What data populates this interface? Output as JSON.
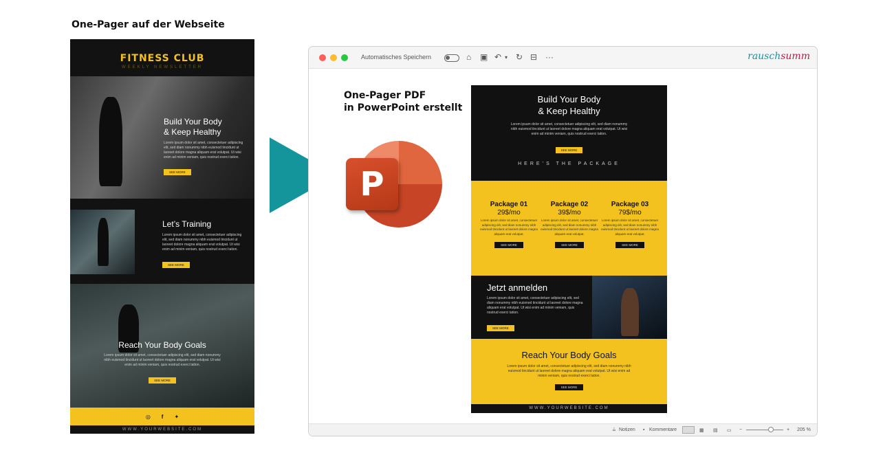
{
  "left": {
    "heading": "One-Pager auf der Webseite",
    "brand": "FITNESS CLUB",
    "brand_sub": "WEEKLY NEWSLETTER",
    "hero_title_1": "Build Your Body",
    "hero_title_2": "& Keep Healthy",
    "hero_lorem": "Lorem ipsum dolor sit amet, consectetuer adipiscing elit, sed diam nonummy nibh euismod tincidunt ut laoreet dolore magna aliquam erat volutpat. Ut wisi enim ad minim veniam, quis nostrud exerci tation.",
    "btn": "SEE MORE",
    "training_title": "Let’s Training",
    "training_lorem": "Lorem ipsum dolor sit amet, consectetuer adipiscing elit, sed diam nonummy nibh euismod tincidunt ut laoreet dolore magna aliquam erat volutpat. Ut wisi enim ad minim veniam, quis nostrud exerci tation.",
    "goals_title": "Reach Your Body Goals",
    "goals_lorem": "Lorem ipsum dolor sit amet, consectetuer adipiscing elit, sed diam nonummy nibh euismod tincidunt ut laoreet dolore magna aliquam erat volutpat. Ut wisi enim ad minim veniam, quis nostrud exerci tation.",
    "website": "WWW.YOURWEBSITE.COM"
  },
  "window": {
    "autosave_label": "Automatisches Speichern",
    "logo_part1": "rausch",
    "logo_part2": "summ",
    "status": {
      "notes": "Notizen",
      "comments": "Kommentare",
      "zoom": "205 %"
    }
  },
  "pdf_caption_1": "One-Pager PDF",
  "pdf_caption_2": "in PowerPoint erstellt",
  "ppt_letter": "P",
  "pdf": {
    "hero_title_1": "Build Your Body",
    "hero_title_2": "& Keep Healthy",
    "hero_lorem": "Lorem ipsum dolor sit amet, consectetuer adipiscing elit, sed diam nonummy nibh euismod tincidunt ut laoreet dolore magna aliquam erat volutpat. Ut wisi enim ad minim veniam, quis nostrud exerci tation.",
    "btn": "SEE MORE",
    "package_heading": "HERE’S THE PACKAGE",
    "packages": [
      {
        "name": "Package 01",
        "price": "29$/mo",
        "lorem": "Lorem ipsum dolor sit amet, consectetuer adipiscing elit, sed diam nonummy nibh euismod tincidunt ut laoreet dolore magna aliquam erat volutpat."
      },
      {
        "name": "Package 02",
        "price": "39$/mo",
        "lorem": "Lorem ipsum dolor sit amet, consectetuer adipiscing elit, sed diam nonummy nibh euismod tincidunt ut laoreet dolore magna aliquam erat volutpat."
      },
      {
        "name": "Package 03",
        "price": "79$/mo",
        "lorem": "Lorem ipsum dolor sit amet, consectetuer adipiscing elit, sed diam nonummy nibh euismod tincidunt ut laoreet dolore magna aliquam erat volutpat."
      }
    ],
    "signup_title": "Jetzt anmelden",
    "signup_lorem": "Lorem ipsum dolor sit amet, consectetuer adipiscing elit, sed diam nonummy nibh euismod tincidunt ut laoreet dolore magna aliquam erat volutpat. Ut wisi enim ad minim veniam, quis nostrud exerci tation.",
    "goals_title": "Reach Your Body Goals",
    "goals_lorem": "Lorem ipsum dolor sit amet, consectetuer adipiscing elit, sed diam nonummy nibh euismod tincidunt ut laoreet dolore magna aliquam erat volutpat. Ut wisi enim ad minim veniam, quis nostrud exerci tation.",
    "website": "WWW.YOURWEBSITE.COM"
  },
  "colors": {
    "accent_yellow": "#f4c21f",
    "arrow_teal": "#14949b",
    "dark": "#121212"
  }
}
